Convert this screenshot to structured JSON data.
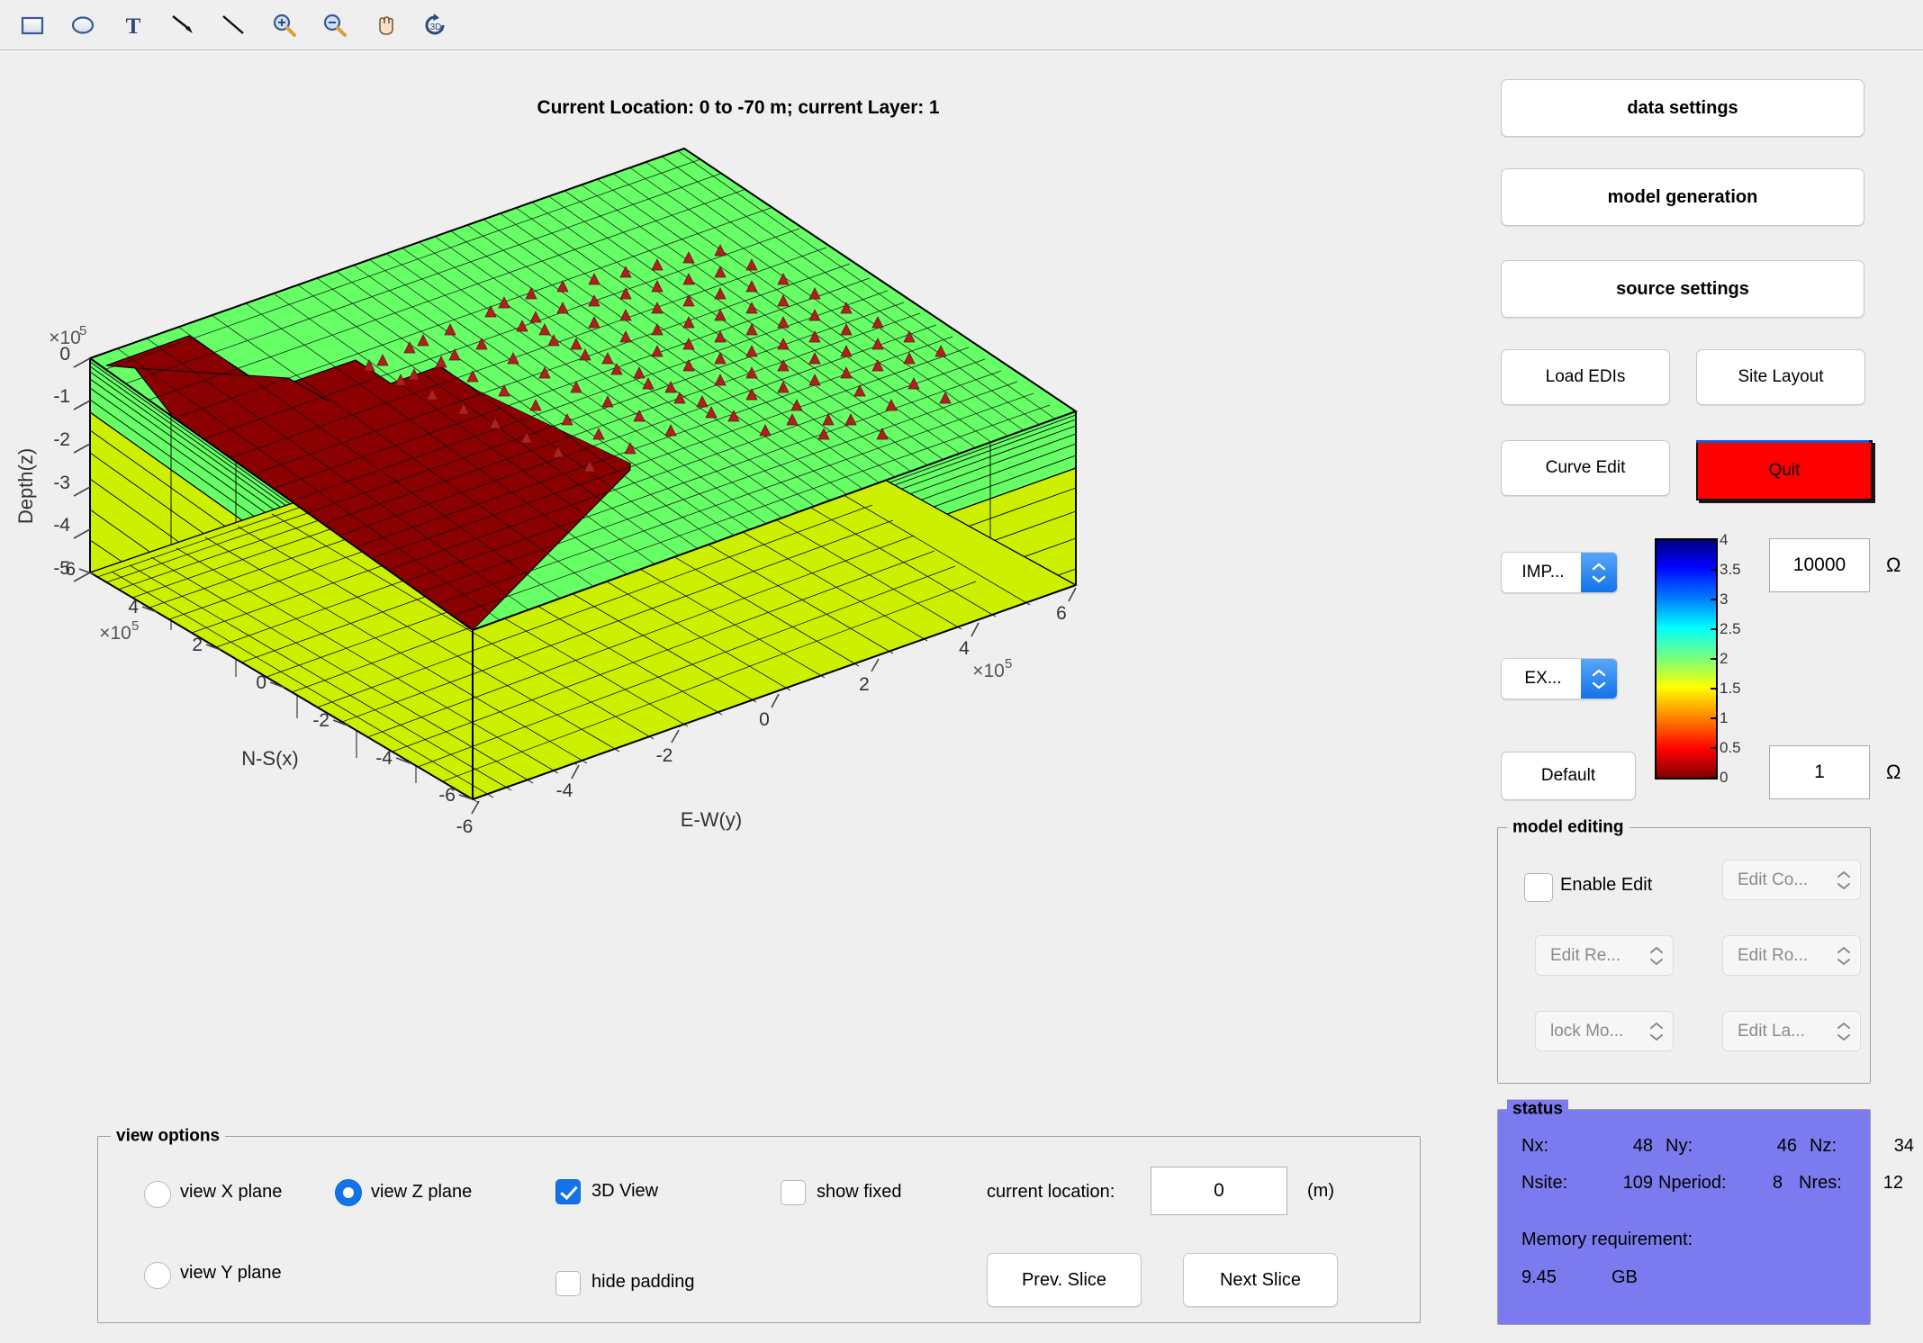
{
  "toolbar": {
    "icons": [
      {
        "name": "rectangle-tool-icon",
        "label": "rectangle"
      },
      {
        "name": "ellipse-tool-icon",
        "label": "ellipse"
      },
      {
        "name": "text-tool-icon",
        "label": "text"
      },
      {
        "name": "arrow-tool-icon",
        "label": "arrow"
      },
      {
        "name": "line-tool-icon",
        "label": "line"
      },
      {
        "name": "zoom-in-icon",
        "label": "zoom in"
      },
      {
        "name": "zoom-out-icon",
        "label": "zoom out"
      },
      {
        "name": "pan-hand-icon",
        "label": "pan"
      },
      {
        "name": "rotate-3d-icon",
        "label": "rotate 3d"
      }
    ]
  },
  "figure": {
    "title": "Current Location: 0 to -70 m; current Layer: 1"
  },
  "chart_data": {
    "type": "heatmap",
    "title": "Current Location: 0 to -70 m; current Layer: 1",
    "xlabel": "N-S(x)",
    "ylabel": "E-W(y)",
    "zlabel": "Depth(z)",
    "x_exponent": "×10⁵",
    "y_exponent": "×10⁵",
    "z_exponent": "×10⁵",
    "x_ticks": [
      6,
      4,
      2,
      0,
      -2,
      -4,
      -6
    ],
    "y_ticks": [
      -6,
      -4,
      -2,
      0,
      2,
      4,
      6
    ],
    "z_ticks": [
      0,
      -1,
      -2,
      -3,
      -4,
      -5
    ],
    "colors": {
      "surface_green": "#66ff66",
      "surface_yellow": "#ccf000",
      "anomaly_dark_red": "#8b0000",
      "site_marker": "#e01b1b",
      "mesh_line": "#000000"
    },
    "site_count": 109,
    "view": "3D"
  },
  "side_buttons": {
    "data_settings": "data settings",
    "model_generation": "model generation",
    "source_settings": "source settings",
    "load_edis": "Load EDIs",
    "site_layout": "Site Layout",
    "curve_edit": "Curve Edit",
    "quit": "Quit",
    "default": "Default"
  },
  "colormap": {
    "impedance_menu": "IMP...",
    "extra_menu": "EX...",
    "ticks": [
      "4",
      "3.5",
      "3",
      "2.5",
      "2",
      "1.5",
      "1",
      "0.5",
      "0"
    ],
    "max_value": "10000",
    "min_value": "1",
    "unit_symbol": "Ω"
  },
  "model_editing": {
    "title": "model editing",
    "enable_edit_label": "Enable Edit",
    "enable_edit_checked": false,
    "edit_co": "Edit Co...",
    "edit_re": "Edit Re...",
    "edit_ro": "Edit Ro...",
    "lock_mo": "lock Mo...",
    "edit_la": "Edit La..."
  },
  "status": {
    "title": "status",
    "nx_label": "Nx:",
    "nx_value": "48",
    "ny_label": "Ny:",
    "ny_value": "46",
    "nz_label": "Nz:",
    "nz_value": "34",
    "nsite_label": "Nsite:",
    "nsite_value": "109",
    "nperiod_label": "Nperiod:",
    "nperiod_value": "8",
    "nres_label": "Nres:",
    "nres_value": "12",
    "memory_label": "Memory requirement:",
    "memory_value": "9.45",
    "memory_unit": "GB",
    "background_color": "#7b7bef"
  },
  "view_options": {
    "title": "view options",
    "view_x_plane": "view X plane",
    "view_y_plane": "view Y plane",
    "view_z_plane": "view Z plane",
    "view_z_selected": true,
    "three_d_view": "3D View",
    "three_d_checked": true,
    "show_fixed": "show fixed",
    "show_fixed_checked": false,
    "hide_padding": "hide padding",
    "hide_padding_checked": false,
    "current_location_label": "current location:",
    "current_location_value": "0",
    "units": "(m)",
    "prev_slice": "Prev. Slice",
    "next_slice": "Next Slice"
  }
}
